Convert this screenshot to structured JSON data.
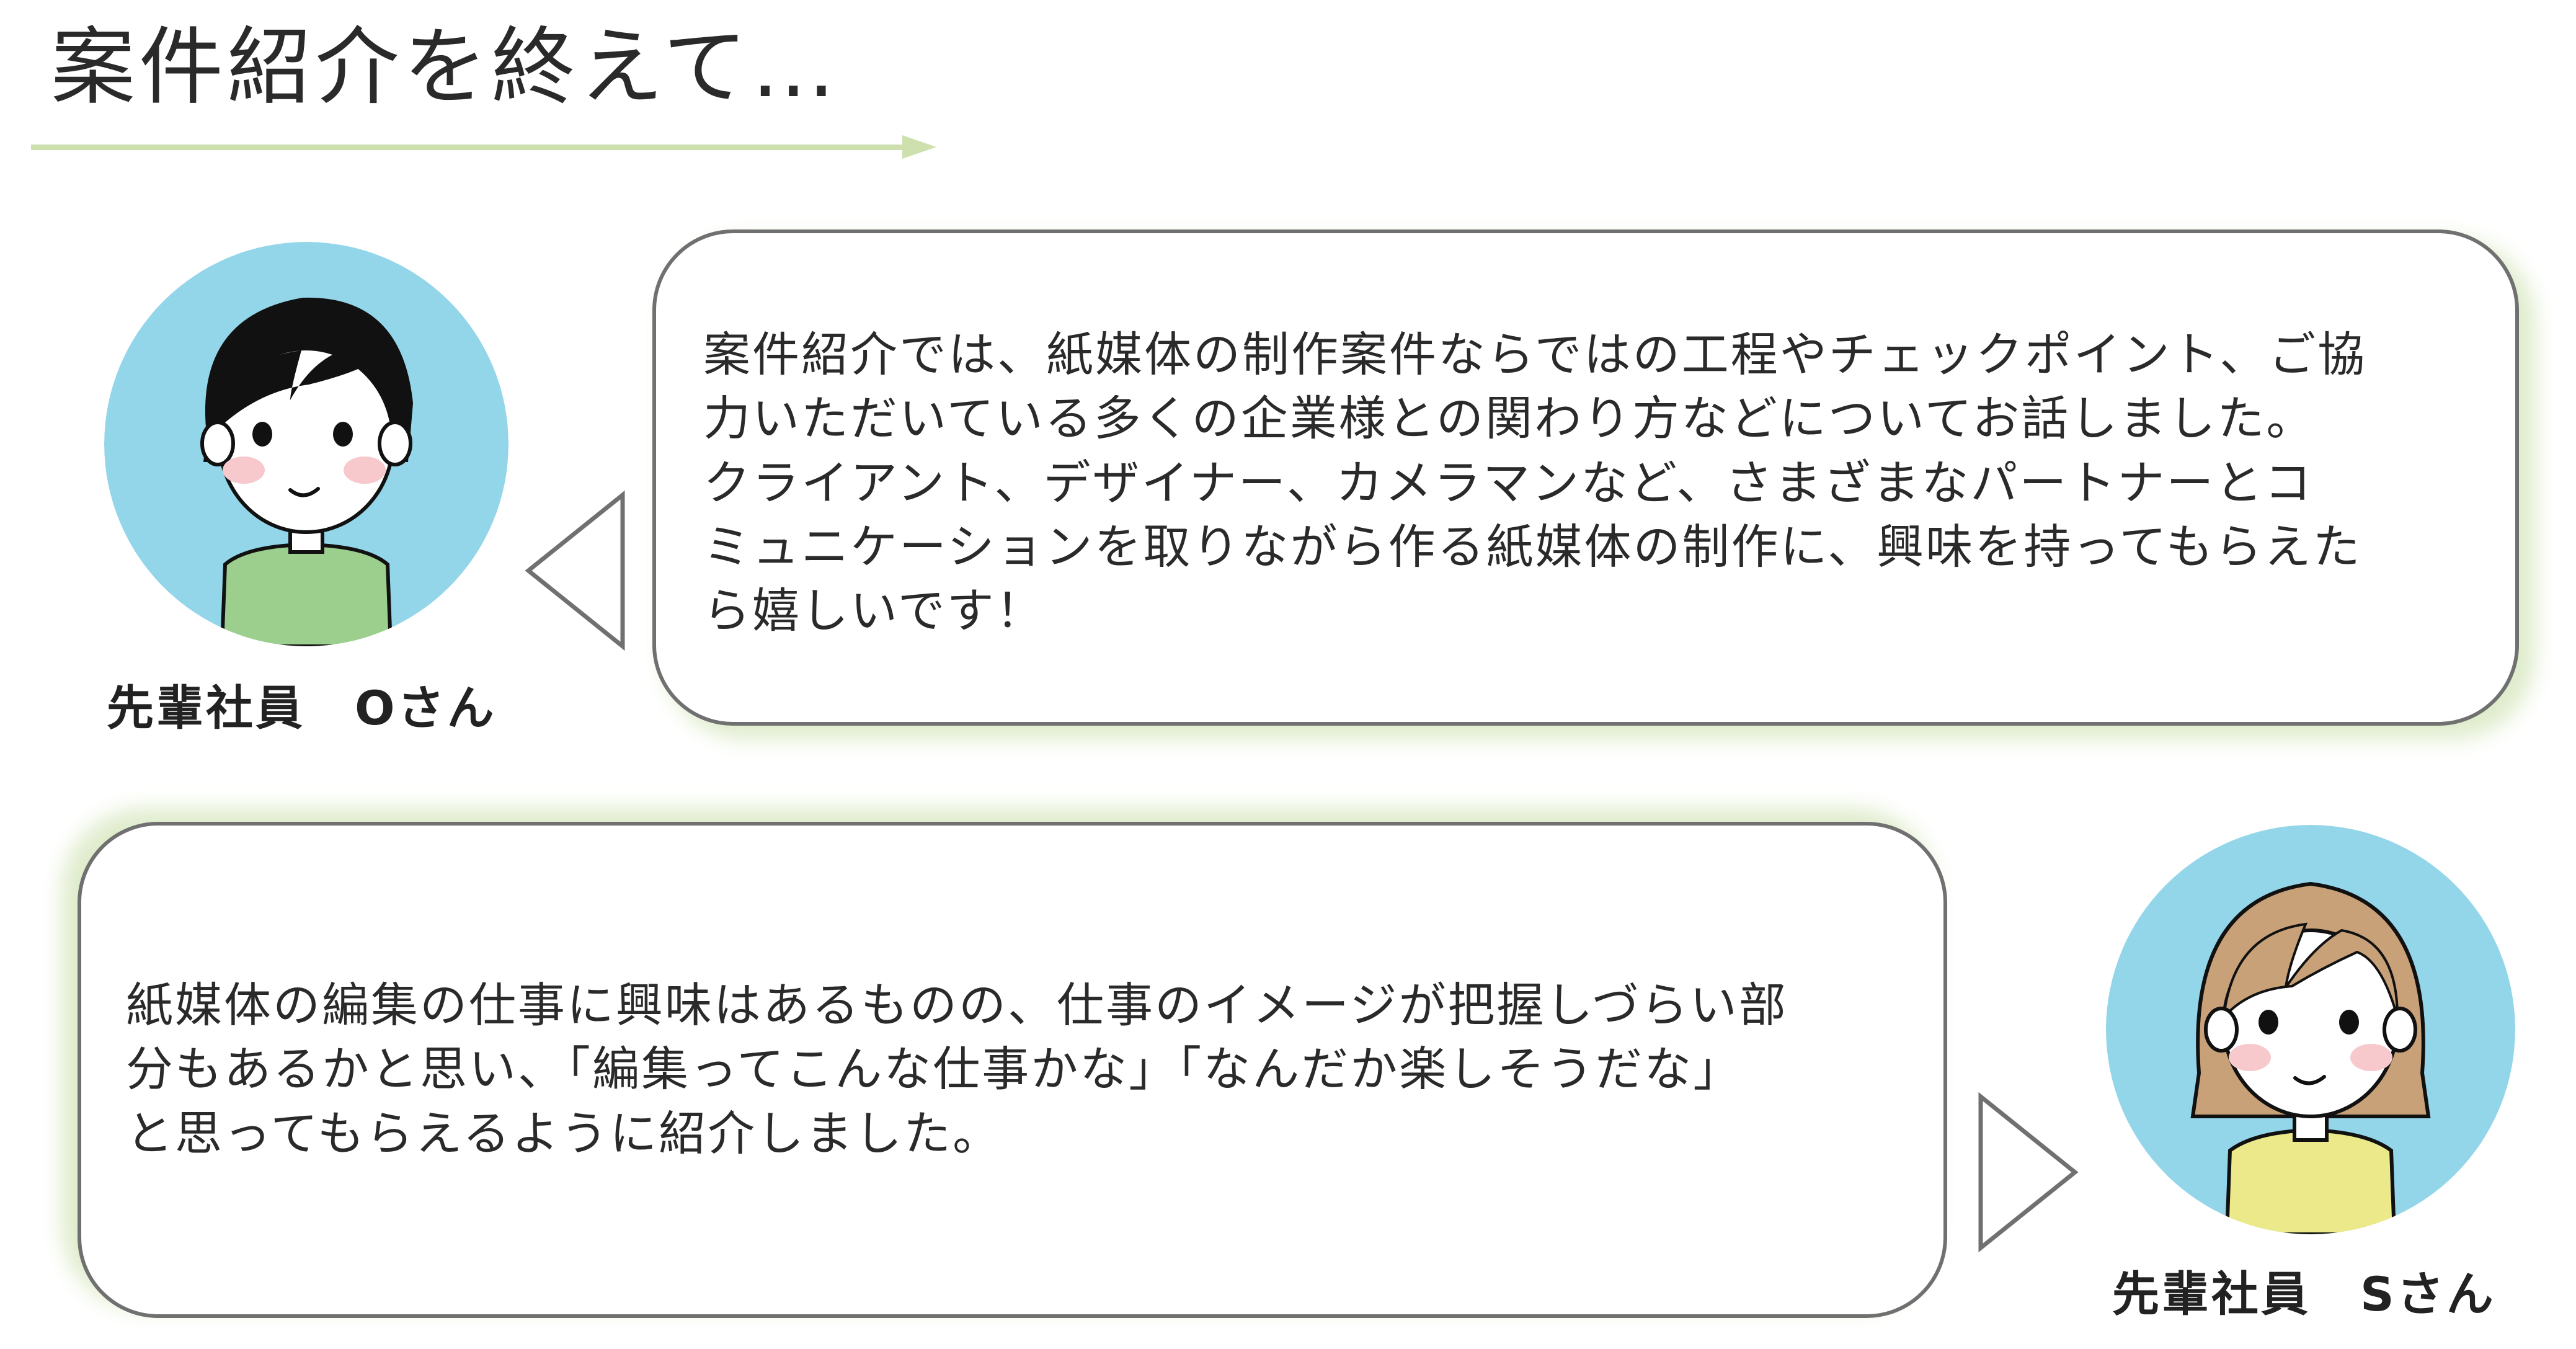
{
  "page_title": "案件紹介を終えて…",
  "colors": {
    "accent_green": "#cde0ad",
    "bubble_border": "#707070",
    "bubble_glow": "#dfeccc",
    "avatar_bg": "#93d5e9",
    "shirt_o": "#9ccf8d",
    "shirt_s": "#ebe98a",
    "hair_o": "#111111",
    "hair_s": "#c9a178"
  },
  "icons": {
    "title_arrow": "arrow-right-icon",
    "avatar_o": "avatar-icon",
    "avatar_s": "avatar-icon",
    "pointer_o": "triangle-left-icon",
    "pointer_s": "triangle-right-icon"
  },
  "speakers": {
    "o": {
      "label": "先輩社員　Oさん",
      "message": "案件紹介では、紙媒体の制作案件ならではの工程やチェックポイント、ご協\n力いただいている多くの企業様との関わり方などについてお話しました。\nクライアント、デザイナー、カメラマンなど、さまざまなパートナーとコ\nミュニケーションを取りながら作る紙媒体の制作に、興味を持ってもらえた\nら嬉しいです！"
    },
    "s": {
      "label": "先輩社員　Sさん",
      "message": "紙媒体の編集の仕事に興味はあるものの、仕事のイメージが把握しづらい部\n分もあるかと思い、「編集ってこんな仕事かな」「なんだか楽しそうだな」\nと思ってもらえるように紹介しました。"
    }
  }
}
